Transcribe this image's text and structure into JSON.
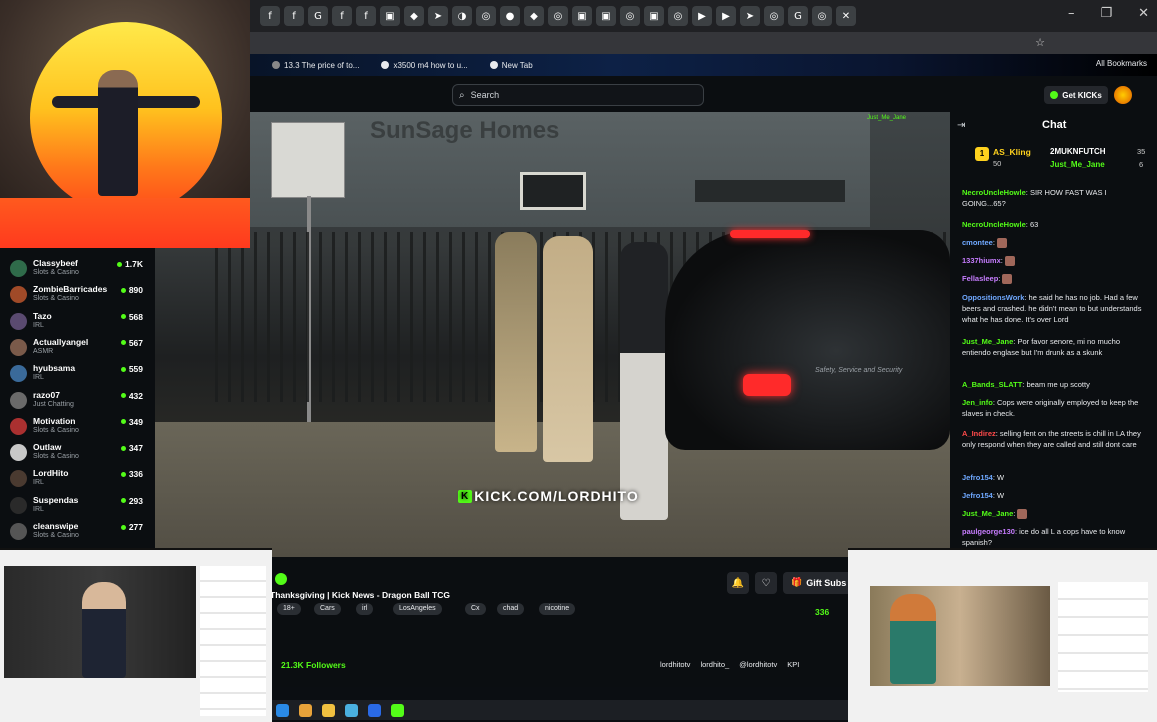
{
  "browser": {
    "tab_icons": [
      "f",
      "f",
      "G",
      "f",
      "f",
      "▣",
      "◆",
      "➤",
      "◑",
      "◎",
      "●",
      "◆",
      "◎",
      "▣",
      "▣",
      "◎",
      "▣",
      "◎",
      "▶",
      "▶",
      "➤",
      "◎",
      "G",
      "◎",
      "✕"
    ],
    "window_controls": [
      "–",
      "❐",
      "✕"
    ],
    "bookmarks": [
      "13.3 The price of to...",
      "x3500 m4 how to u...",
      "New Tab"
    ],
    "all_bookmarks": "All Bookmarks"
  },
  "header": {
    "search_placeholder": "Search",
    "get_kicks_label": "Get KICKs"
  },
  "video": {
    "watermark": "KICK.COM/LORDHITO",
    "sign_text": "SunSage Homes",
    "car_text": "Safety, Service and Security",
    "overlay_user": "Just_Me_Jane"
  },
  "sidebar": {
    "channels": [
      {
        "name": "Classybeef",
        "category": "Slots & Casino",
        "viewers": "1.7K",
        "color": "#2f6b4a"
      },
      {
        "name": "ZombieBarricades",
        "category": "Slots & Casino",
        "viewers": "890",
        "color": "#a04a28"
      },
      {
        "name": "Tazo",
        "category": "IRL",
        "viewers": "568",
        "color": "#5a4a70"
      },
      {
        "name": "Actuallyangel",
        "category": "ASMR",
        "viewers": "567",
        "color": "#7a5a4a"
      },
      {
        "name": "hyubsama",
        "category": "IRL",
        "viewers": "559",
        "color": "#3a6a9a"
      },
      {
        "name": "razo07",
        "category": "Just Chatting",
        "viewers": "432",
        "color": "#6a6a6a"
      },
      {
        "name": "Motivation",
        "category": "Slots & Casino",
        "viewers": "349",
        "color": "#aa3030"
      },
      {
        "name": "Outlaw",
        "category": "Slots & Casino",
        "viewers": "347",
        "color": "#c8c8c8"
      },
      {
        "name": "LordHito",
        "category": "IRL",
        "viewers": "336",
        "color": "#4a3a30"
      },
      {
        "name": "Suspendas",
        "category": "IRL",
        "viewers": "293",
        "color": "#2a2a2a"
      },
      {
        "name": "cleanswipe",
        "category": "Slots & Casino",
        "viewers": "277",
        "color": "#555555"
      }
    ]
  },
  "chat": {
    "title": "Chat",
    "gifters": [
      {
        "name": "AS_Kling",
        "count": "50",
        "color": "#ffd21e"
      },
      {
        "name": "2MUKNFUTCH",
        "count": "35",
        "color": "#ffffff"
      },
      {
        "name": "Just_Me_Jane",
        "count": "6",
        "color": "#53fc18"
      }
    ],
    "messages": [
      {
        "user": "NecroUncleHowle",
        "color": "#53fc18",
        "text": ": SIR HOW FAST WAS I GOING...65?"
      },
      {
        "user": "NecroUncleHowle",
        "color": "#53fc18",
        "text": ": 63"
      },
      {
        "user": "cmontee",
        "color": "#6fa8ff",
        "text": ":"
      },
      {
        "user": "1337hiumx",
        "color": "#c77dff",
        "text": ":"
      },
      {
        "user": "Fellasleep",
        "color": "#c77dff",
        "text": ":"
      },
      {
        "user": "OppositionsWork",
        "color": "#6fa8ff",
        "text": ": he said he has no job. Had a few beers and crashed. he didn't mean to but understands what he has done. It's over Lord"
      },
      {
        "user": "Just_Me_Jane",
        "color": "#53fc18",
        "text": ": Por favor senore, mi no mucho entiendo englase but I'm drunk as a skunk"
      },
      {
        "user": "A_Bands_SLATT",
        "color": "#53fc18",
        "text": ": beam me up scotty"
      },
      {
        "user": "Jen_info",
        "color": "#53fc18",
        "text": ": Cops were originally employed to keep the slaves in check."
      },
      {
        "user": "A_Indirez",
        "color": "#ff4a4a",
        "text": ": selling fent on the streets is chill in LA they only respond when they are called and still dont care"
      },
      {
        "user": "Jefro154",
        "color": "#6fa8ff",
        "text": ": W"
      },
      {
        "user": "Jefro154",
        "color": "#6fa8ff",
        "text": ": W"
      },
      {
        "user": "Just_Me_Jane",
        "color": "#53fc18",
        "text": ":"
      },
      {
        "user": "paulgeorge130",
        "color": "#c77dff",
        "text": ": ice do all L a cops have to know spanish?"
      }
    ]
  },
  "stream": {
    "title": "Thanksgiving | Kick News - Dragon Ball TCG",
    "tags": [
      "18+",
      "Cars",
      "irl",
      "LosAngeles",
      "Cx",
      "chad",
      "nicotine"
    ],
    "followers": "21.3K Followers",
    "gift_subs_label": "Gift Subs",
    "viewers": "336",
    "socials": [
      "lordhitotv",
      "lordhito_",
      "@lordhitotv",
      "KPI"
    ]
  },
  "colors": {
    "kick_green": "#53fc18",
    "bg": "#0b0e11"
  }
}
